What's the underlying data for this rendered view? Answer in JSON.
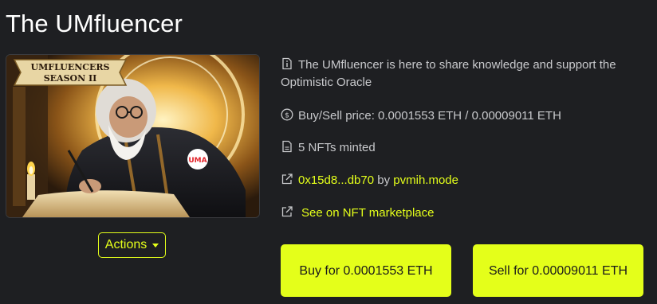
{
  "page_title": "The UMfluencer",
  "nft_image": {
    "banner_line1": "UMFLUENCERS",
    "banner_line2": "SEASON II",
    "badge_text": "UMA"
  },
  "actions": {
    "label": "Actions"
  },
  "info": {
    "description": "The UMfluencer is here to share knowledge and support the Optimistic Oracle",
    "price_text": "Buy/Sell price: 0.0001553 ETH / 0.00009011 ETH",
    "minted_text": "5 NFTs minted",
    "owner_address": "0x15d8...db70",
    "owner_by": "by",
    "owner_name": "pvmih.mode",
    "marketplace_link": "See on NFT marketplace"
  },
  "buttons": {
    "buy_label": "Buy for 0.0001553 ETH",
    "sell_label": "Sell for 0.00009011 ETH"
  },
  "colors": {
    "background": "#1e1f22",
    "accent": "#e4ff1a",
    "text": "#c8c9cc",
    "title": "#ffffff"
  },
  "icons": {
    "description": "info-icon",
    "price": "coin-icon",
    "minted": "document-icon",
    "owner": "external-link-icon",
    "marketplace": "external-link-icon"
  }
}
